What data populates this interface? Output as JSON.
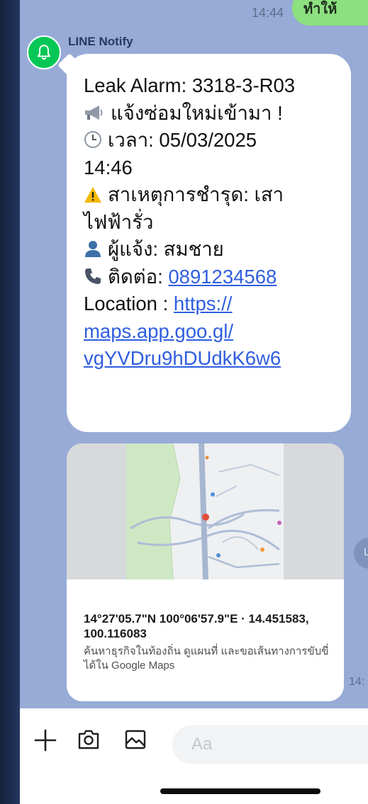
{
  "colors": {
    "chat_background": "#97abd6",
    "message_bubble": "#ffffff",
    "outgoing_bubble": "#8de07f",
    "link": "#2f5ee0",
    "avatar": "#06c755",
    "input_bar": "#ffffff"
  },
  "previous_message": {
    "time": "14:44",
    "text": "ทำให้"
  },
  "sender": {
    "name": "LINE Notify",
    "avatar_icon": "bell-icon"
  },
  "message": {
    "line1": "Leak Alarm: 3318-3-R03",
    "line2": "แจ้งซ่อมใหม่เข้ามา !",
    "line3": "เวลา: 05/03/2025",
    "line4": "14:46",
    "line5": "สาเหตุการชำรุด: เสา",
    "line6": "ไฟฟ้ารั่ว",
    "line7": "ผู้แจ้ง: สมชาย",
    "line8_label": "ติดต่อ: ",
    "phone": "0891234568",
    "location_label": "Location : ",
    "link_part1": "https://",
    "link_part2": "maps.app.goo.gl/",
    "link_part3": "vgYVDru9hDUdkK6w6",
    "icons": [
      "megaphone-icon",
      "clock-icon",
      "warning-icon",
      "person-icon",
      "phone-icon"
    ]
  },
  "map_preview": {
    "title": "14°27'05.7\"N 100°06'57.9\"E · 14.451583, 100.116083",
    "description": "ค้นหาธุรกิจในท้องถิ่น ดูแผนที่ และขอเส้นทางการขับขี่ได้ใน Google Maps",
    "time": "14:",
    "side_badge": "L"
  },
  "input_bar": {
    "placeholder": "Aa",
    "icons": [
      "plus-icon",
      "camera-icon",
      "image-icon"
    ]
  }
}
